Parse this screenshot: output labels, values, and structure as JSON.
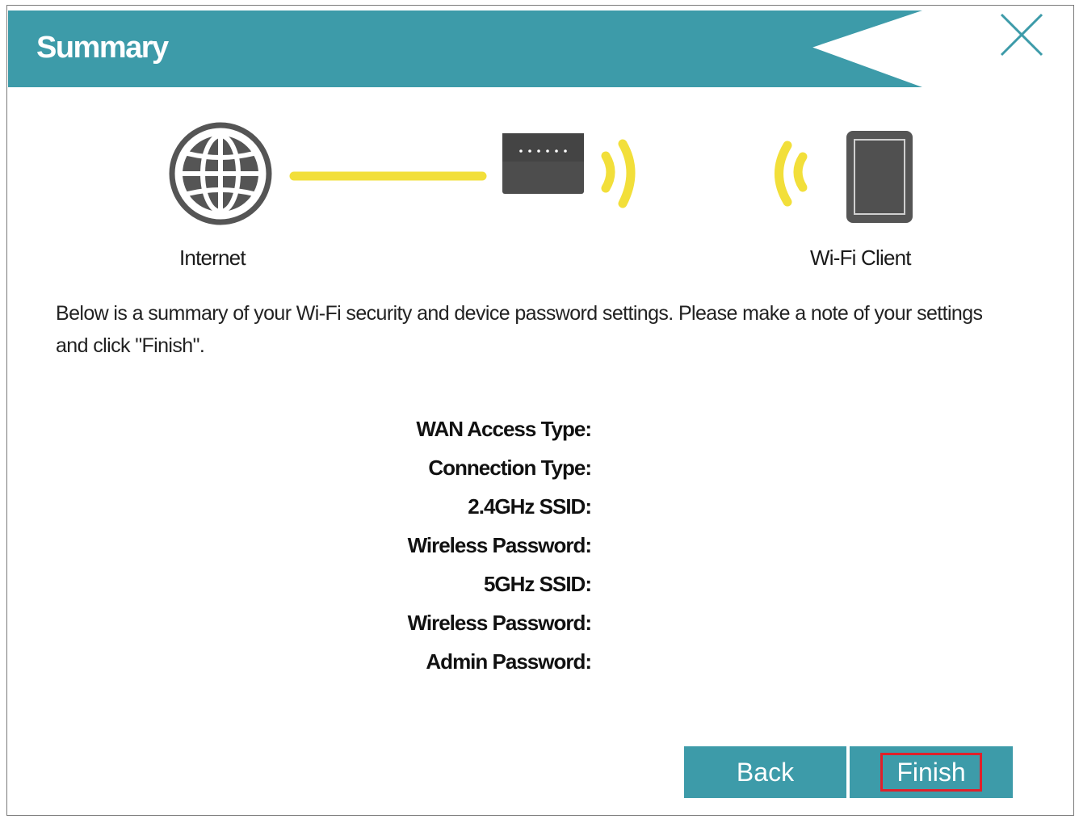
{
  "dialog": {
    "title": "Summary",
    "close_icon": "close-icon"
  },
  "diagram": {
    "internet_label": "Internet",
    "client_label": "Wi-Fi Client",
    "icons": [
      "globe-icon",
      "router-icon",
      "wifi-signal-icon",
      "tablet-icon"
    ],
    "colors": {
      "accent": "#3d9ba9",
      "signal": "#f2df3a",
      "device": "#4d4d4d"
    }
  },
  "description": "Below is a summary of your Wi-Fi security and device password settings. Please make a note of your settings and click \"Finish\".",
  "summary": {
    "fields": [
      {
        "label": "WAN Access Type:",
        "value": ""
      },
      {
        "label": "Connection Type:",
        "value": ""
      },
      {
        "label": "2.4GHz SSID:",
        "value": ""
      },
      {
        "label": "Wireless Password:",
        "value": ""
      },
      {
        "label": "5GHz SSID:",
        "value": ""
      },
      {
        "label": "Wireless Password:",
        "value": ""
      },
      {
        "label": "Admin Password:",
        "value": ""
      }
    ]
  },
  "buttons": {
    "back": "Back",
    "finish": "Finish",
    "highlight_color": "#e0202a"
  }
}
